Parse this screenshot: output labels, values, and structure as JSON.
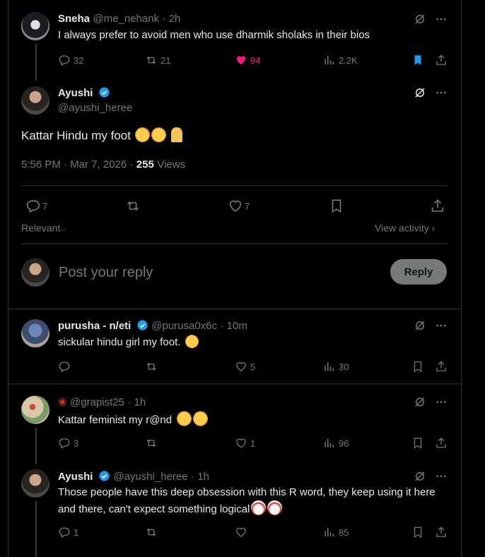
{
  "tweets": {
    "sneha": {
      "name": "Sneha",
      "handle": "@me_nehank",
      "time": "· 2h",
      "text": "I always prefer to avoid men who use dharmik sholaks in their bios",
      "replies": "32",
      "retweets": "21",
      "likes": "94",
      "views": "2.2K",
      "like_color": "#f91880",
      "bookmark_color": "#1d9bf0"
    },
    "main": {
      "name": "Ayushi",
      "handle": "@ayushi_heree",
      "text": "Kattar Hindu my foot",
      "timestamp": "5:56 PM · Mar 7, 2026 ·",
      "views_count": "255",
      "views_label": "Views",
      "replies": "7",
      "likes": "7"
    },
    "purusha": {
      "name": "purusha - n/eti",
      "handle": "@purusa0x6c",
      "time": "· 10m",
      "text": "sickular hindu girl my foot.",
      "likes": "5",
      "views": "30"
    },
    "grapist": {
      "handle": "@grapist25",
      "time": "· 1h",
      "text": "Kattar feminist my r@nd",
      "replies": "3",
      "likes": "1",
      "views": "96"
    },
    "ayushi_reply": {
      "name": "Ayushi",
      "handle": "@ayushi_heree",
      "time": "· 1h",
      "text": "Those  people have this deep obsession with this R word, they keep using it here and there, can't expect something logical",
      "replies": "1",
      "views": "85"
    }
  },
  "sort": {
    "relevant_label": "Relevant",
    "view_activity_label": "View activity"
  },
  "composer": {
    "placeholder": "Post your reply",
    "reply_button": "Reply"
  },
  "colors": {
    "verified": "#1d9bf0",
    "muted": "#71767b",
    "border": "#2f3336"
  }
}
